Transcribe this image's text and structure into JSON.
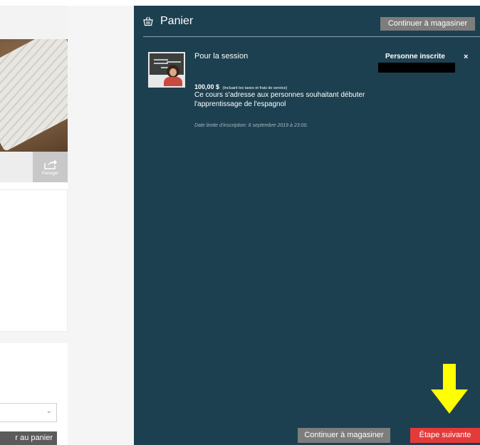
{
  "left_page": {
    "share_label": "Partager",
    "add_to_cart_label": "r au panier"
  },
  "cart": {
    "title": "Panier",
    "continue_shopping_top": "Continuer à magasiner",
    "item": {
      "session_label": "Pour la session",
      "registered_person_label": "Personne inscrite",
      "remove_symbol": "×",
      "price": "100,00 $",
      "price_note": "(Incluant les taxes et frais de service)",
      "description": "Ce cours s'adresse aux personnes souhaitant débuter l'apprentissage de l'espagnol",
      "deadline": "Date limite d'inscription: 6 septembre 2019 à 23:00."
    },
    "continue_shopping_bottom": "Continuer à magasiner",
    "next_step": "Étape suivante"
  },
  "colors": {
    "panel_bg": "#1d4050",
    "next_button": "#e53a3a",
    "secondary_button": "#7d7d7d",
    "annotation_arrow": "#ffff00"
  },
  "icons": {
    "basket": "basket-icon",
    "share": "share-icon",
    "chevron": "chevron-down-icon",
    "arrow": "arrow-down-icon"
  }
}
